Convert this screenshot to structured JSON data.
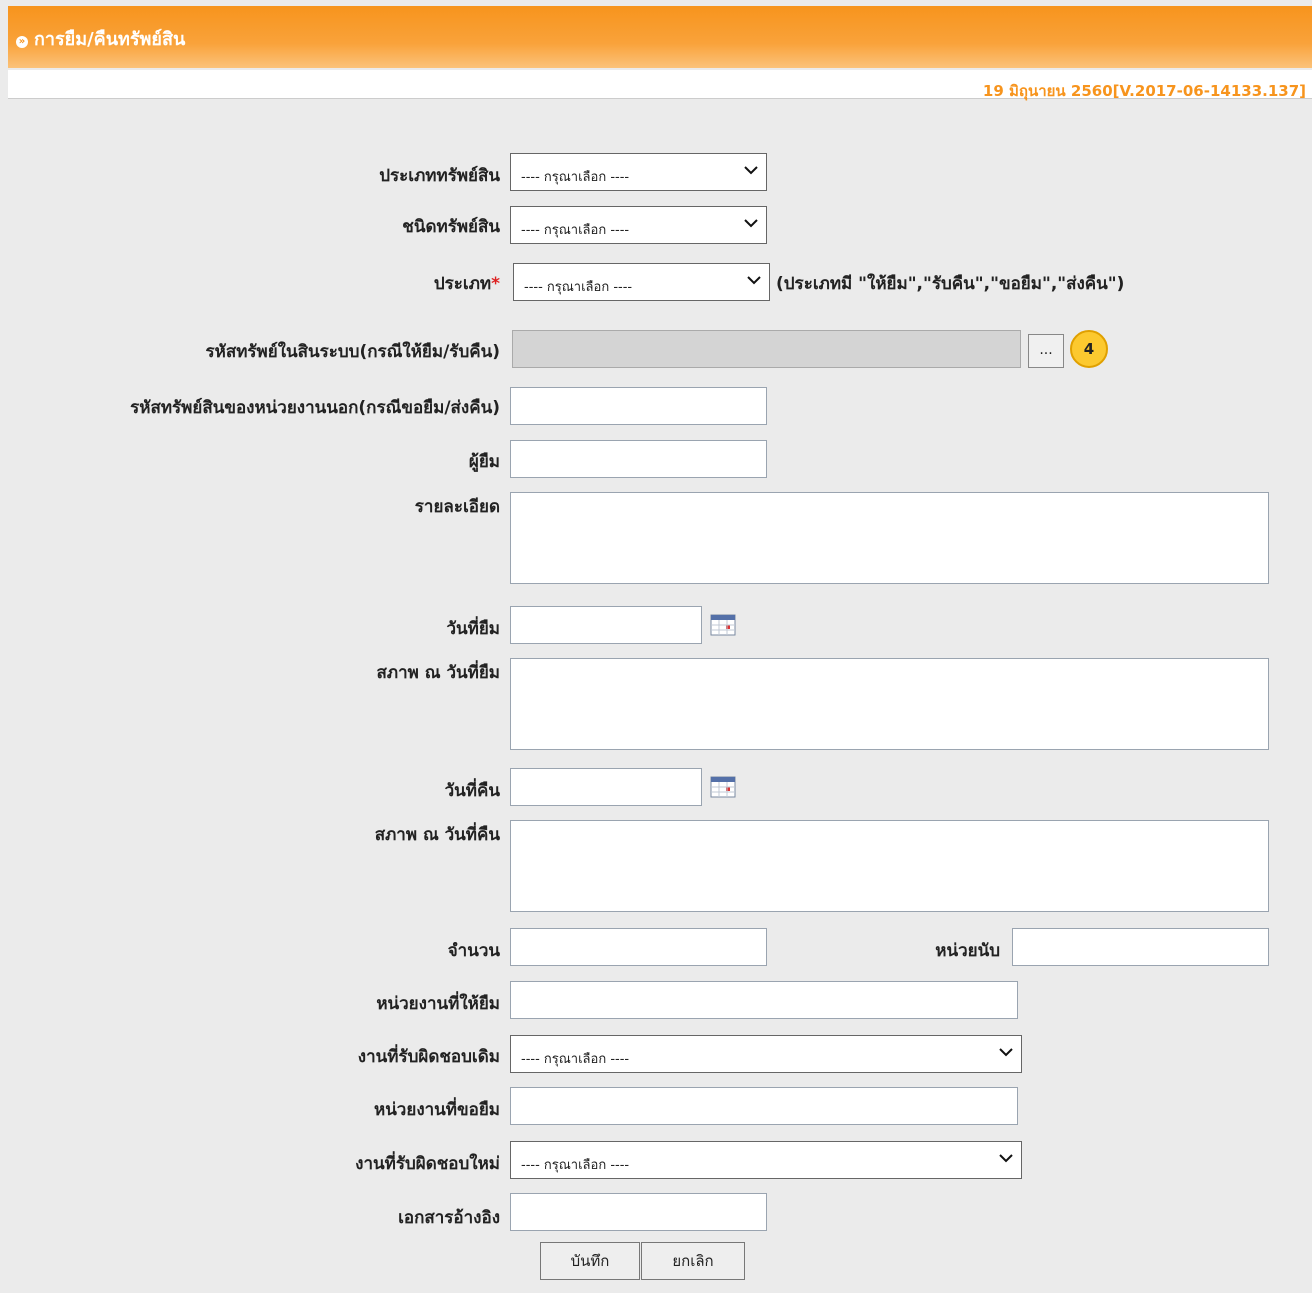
{
  "header": {
    "title": "การยืม/คืนทรัพย์สิน",
    "version": "19 มิถุนายน 2560[V.2017-06-14133.137]"
  },
  "form": {
    "asset_category": {
      "label": "ประเภททรัพย์สิน",
      "value": "---- กรุณาเลือก ----"
    },
    "asset_kind": {
      "label": "ชนิดทรัพย์สิน",
      "value": "---- กรุณาเลือก ----"
    },
    "type": {
      "label": "ประเภท",
      "required_mark": "*",
      "value": "---- กรุณาเลือก ----",
      "note": "(ประเภทมี \"ให้ยืม\",\"รับคืน\",\"ขอยืม\",\"ส่งคืน\")"
    },
    "internal_code": {
      "label": "รหัสทรัพย์ในสินระบบ(กรณีให้ยืม/รับคืน)",
      "value": "",
      "browse_label": "...",
      "badge": "4"
    },
    "external_code": {
      "label": "รหัสทรัพย์สินของหน่วยงานนอก(กรณีขอยืม/ส่งคืน)",
      "value": ""
    },
    "borrower": {
      "label": "ผู้ยืม",
      "value": ""
    },
    "details": {
      "label": "รายละเอียด",
      "value": ""
    },
    "borrow_date": {
      "label": "วันที่ยืม",
      "value": ""
    },
    "borrow_condition": {
      "label": "สภาพ ณ วันที่ยืม",
      "value": ""
    },
    "return_date": {
      "label": "วันที่คืน",
      "value": ""
    },
    "return_condition": {
      "label": "สภาพ ณ วันที่คืน",
      "value": ""
    },
    "quantity": {
      "label": "จำนวน",
      "value": ""
    },
    "unit": {
      "label": "หน่วยนับ",
      "value": ""
    },
    "lending_unit": {
      "label": "หน่วยงานที่ให้ยืม",
      "value": ""
    },
    "old_responsible": {
      "label": "งานที่รับผิดชอบเดิม",
      "value": "---- กรุณาเลือก ----"
    },
    "borrowing_unit": {
      "label": "หน่วยงานที่ขอยืม",
      "value": ""
    },
    "new_responsible": {
      "label": "งานที่รับผิดชอบใหม่",
      "value": "---- กรุณาเลือก ----"
    },
    "reference_doc": {
      "label": "เอกสารอ้างอิง",
      "value": ""
    }
  },
  "buttons": {
    "save": "บันทึก",
    "cancel": "ยกเลิก"
  },
  "colors": {
    "header": "#f7941d",
    "version_text": "#f7941d",
    "badge": "#fcc92f",
    "required": "#d22222"
  },
  "icons": {
    "calendar": "calendar-icon",
    "dropdown": "chevron-down-icon"
  }
}
